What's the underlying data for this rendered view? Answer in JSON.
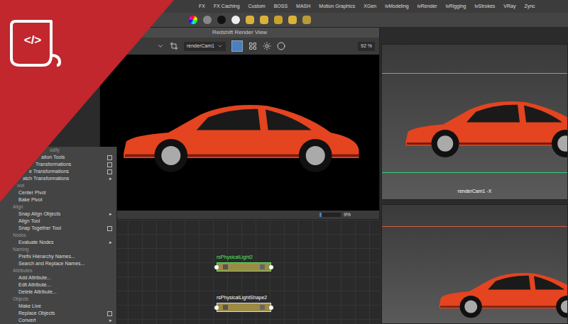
{
  "logo": {
    "glyph": "</>"
  },
  "shelf_tabs": [
    {
      "label": "FX"
    },
    {
      "label": "FX Caching"
    },
    {
      "label": "Custom"
    },
    {
      "label": "BOSS"
    },
    {
      "label": "MASH"
    },
    {
      "label": "Motion Graphics"
    },
    {
      "label": "XGen"
    },
    {
      "label": "ivModeling"
    },
    {
      "label": "ivRender"
    },
    {
      "label": "ivRigging"
    },
    {
      "label": "ivStrokes"
    },
    {
      "label": "VRay"
    },
    {
      "label": "Zync"
    }
  ],
  "render_view": {
    "title": "Redshift Render View",
    "camera": "renderCam1",
    "zoom": "92 %",
    "progress": {
      "reading": "9%",
      "level": 0.09
    }
  },
  "viewport": {
    "label": "renderCam1 -X"
  },
  "menu": {
    "items": [
      {
        "label": "odify",
        "kind": "header",
        "arrow": "",
        "option_box": false
      },
      {
        "label": "ation Tools",
        "kind": "item",
        "arrow": "",
        "option_box": true
      },
      {
        "label": "Transformations",
        "kind": "item",
        "arrow": "",
        "option_box": true
      },
      {
        "label": "e Transformations",
        "kind": "item",
        "arrow": "",
        "option_box": true
      },
      {
        "label": "atch Transformations",
        "kind": "item",
        "arrow": "▸",
        "option_box": false
      },
      {
        "label": "ivot",
        "kind": "header",
        "arrow": "",
        "option_box": false
      },
      {
        "label": "Center Pivot",
        "kind": "item",
        "arrow": "",
        "option_box": false
      },
      {
        "label": "Bake Pivot",
        "kind": "item",
        "arrow": "",
        "option_box": false
      },
      {
        "label": "Align",
        "kind": "header",
        "arrow": "",
        "option_box": false
      },
      {
        "label": "Snap Align Objects",
        "kind": "item",
        "arrow": "▸",
        "option_box": false
      },
      {
        "label": "Align Tool",
        "kind": "item",
        "arrow": "",
        "option_box": false
      },
      {
        "label": "Snap Together Tool",
        "kind": "item",
        "arrow": "",
        "option_box": true
      },
      {
        "label": "Nodes",
        "kind": "header",
        "arrow": "",
        "option_box": false
      },
      {
        "label": "Evaluate Nodes",
        "kind": "item",
        "arrow": "▸",
        "option_box": false
      },
      {
        "label": "Naming",
        "kind": "header",
        "arrow": "",
        "option_box": false
      },
      {
        "label": "Prefix Hierarchy Names...",
        "kind": "item",
        "arrow": "",
        "option_box": false
      },
      {
        "label": "Search and Replace Names...",
        "kind": "item",
        "arrow": "",
        "option_box": false
      },
      {
        "label": "Attributes",
        "kind": "header",
        "arrow": "",
        "option_box": false
      },
      {
        "label": "Add Attribute...",
        "kind": "item",
        "arrow": "",
        "option_box": false
      },
      {
        "label": "Edit Attribute...",
        "kind": "item",
        "arrow": "",
        "option_box": false
      },
      {
        "label": "Delete Attribute...",
        "kind": "item",
        "arrow": "",
        "option_box": false
      },
      {
        "label": "Objects",
        "kind": "header",
        "arrow": "",
        "option_box": false
      },
      {
        "label": "Make Live",
        "kind": "item",
        "arrow": "",
        "option_box": false
      },
      {
        "label": "Replace Objects",
        "kind": "item",
        "arrow": "",
        "option_box": true
      },
      {
        "label": "Convert",
        "kind": "item",
        "arrow": "▸",
        "option_box": false
      }
    ]
  },
  "nodes": [
    {
      "label": "rsPhysicalLight2",
      "selected": true
    },
    {
      "label": "rsPhysicalLightShape2",
      "selected": false
    }
  ]
}
